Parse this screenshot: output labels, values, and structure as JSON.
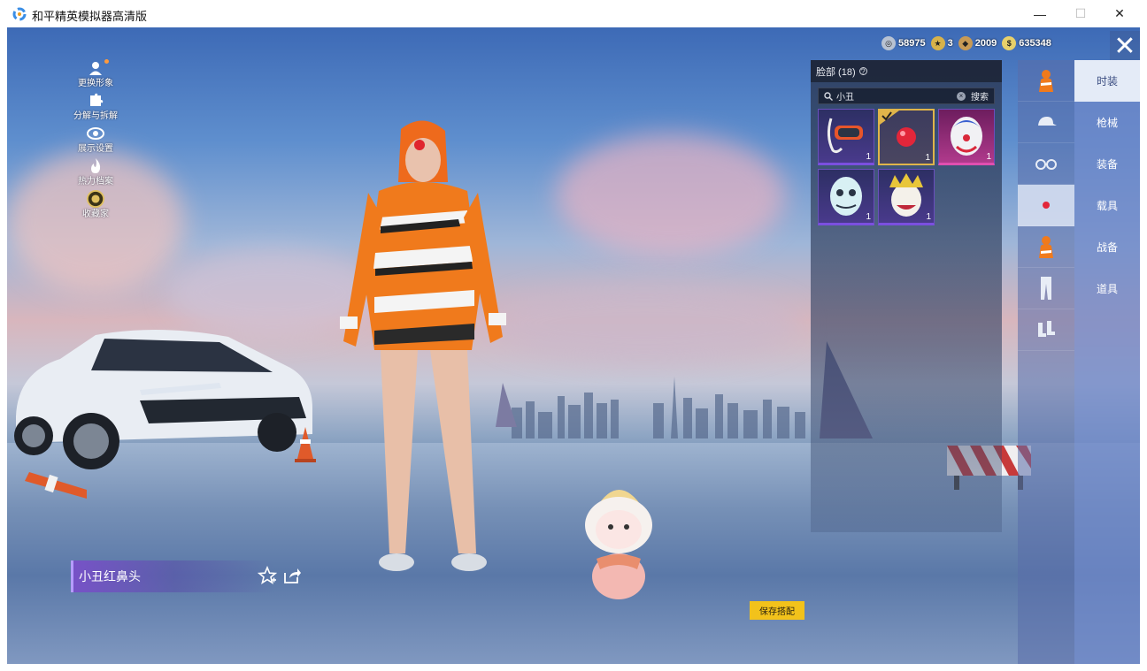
{
  "window": {
    "title": "和平精英模拟器高清版",
    "minimize": "—",
    "maximize": "☐",
    "close": "✕"
  },
  "left_menu": [
    {
      "icon": "avatar-icon",
      "label": "更换形象"
    },
    {
      "icon": "puzzle-icon",
      "label": "分解与拆解"
    },
    {
      "icon": "eye-icon",
      "label": "展示设置"
    },
    {
      "icon": "flame-icon",
      "label": "热力档案"
    },
    {
      "icon": "collection-badge-icon",
      "label": "收藏家"
    }
  ],
  "currencies": [
    {
      "icon": "silver-coin-icon",
      "value": "58975",
      "color": "#b8c2d2"
    },
    {
      "icon": "medal-icon",
      "value": "3",
      "color": "#d8b24a"
    },
    {
      "icon": "bronze-coin-icon",
      "value": "2009",
      "color": "#c89a55"
    },
    {
      "icon": "gold-coin-icon",
      "value": "635348",
      "color": "#e8d06a"
    }
  ],
  "close_label": "✕",
  "inventory": {
    "title": "脸部 (18)",
    "info": "?",
    "search_value": "小丑",
    "search_clear": "×",
    "search_button": "搜索",
    "items": [
      {
        "name": "snorkel-mask",
        "rarity": "purple",
        "count": "1",
        "selected": false
      },
      {
        "name": "clown-red-nose",
        "rarity": "gold",
        "count": "1",
        "selected": true
      },
      {
        "name": "clown-mask-white",
        "rarity": "pink",
        "count": "1",
        "selected": false
      },
      {
        "name": "ghost-mask",
        "rarity": "purple",
        "count": "1",
        "selected": false
      },
      {
        "name": "gold-crown-mask",
        "rarity": "purple",
        "count": "1",
        "selected": false
      }
    ]
  },
  "category_icons": [
    {
      "icon": "character-icon",
      "active": false
    },
    {
      "icon": "cap-icon",
      "active": false
    },
    {
      "icon": "glasses-icon",
      "active": false
    },
    {
      "icon": "red-nose-icon",
      "active": true
    },
    {
      "icon": "top-outfit-icon",
      "active": false
    },
    {
      "icon": "pants-icon",
      "active": false
    },
    {
      "icon": "shoes-icon",
      "active": false
    }
  ],
  "tabs": [
    {
      "label": "时装",
      "active": true
    },
    {
      "label": "枪械",
      "active": false
    },
    {
      "label": "装备",
      "active": false
    },
    {
      "label": "载具",
      "active": false
    },
    {
      "label": "战备",
      "active": false
    },
    {
      "label": "道具",
      "active": false
    }
  ],
  "selected_item_name": "小丑红鼻头",
  "save_button": "保存搭配",
  "colors": {
    "accent_gold": "#f2c21b",
    "rarity_purple": "#7b4fe0",
    "rarity_gold": "#e0b54a",
    "rarity_pink": "#e04fb0"
  }
}
